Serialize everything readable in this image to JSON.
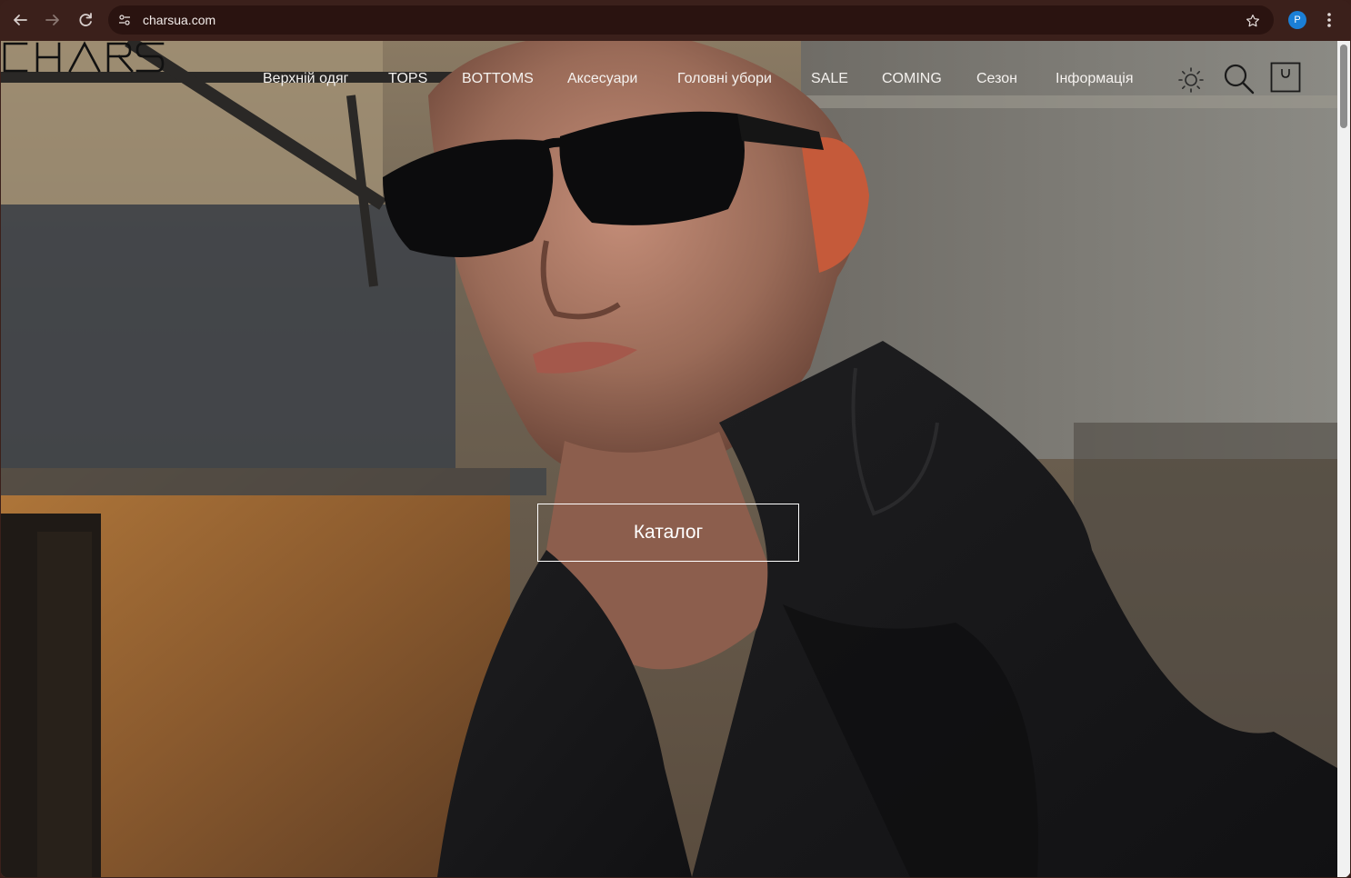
{
  "browser": {
    "back_icon": "arrow-left-icon",
    "forward_icon": "arrow-right-icon",
    "reload_icon": "reload-icon",
    "url": "charsua.com",
    "bookmark_icon": "star-icon",
    "profile_initial": "P",
    "menu_icon": "vertical-dots-icon"
  },
  "site": {
    "logo_text": "CHARS",
    "nav": [
      {
        "label": "Верхній одяг"
      },
      {
        "label": "TOPS"
      },
      {
        "label": "BOTTOMS"
      },
      {
        "label": "Аксесуари"
      },
      {
        "label": "Головні убори"
      },
      {
        "label": "SALE"
      },
      {
        "label": "COMING"
      },
      {
        "label": "Сезон"
      },
      {
        "label": "Інформація"
      }
    ],
    "icons": [
      "sun-theme-icon",
      "search-icon",
      "cart-bag-icon"
    ],
    "hero_button": "Каталог"
  },
  "colors": {
    "browser_chrome": "#3b201b",
    "omnibox": "#2a1310",
    "profile_badge": "#1b7fd6",
    "nav_text": "#f5f2ef",
    "logo": "#111111"
  }
}
